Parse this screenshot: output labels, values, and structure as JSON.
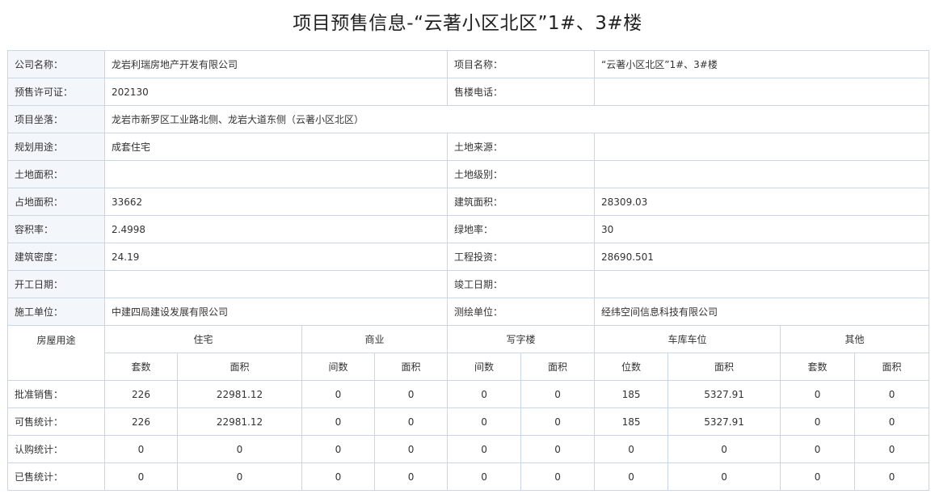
{
  "title": "项目预售信息-“云著小区北区”1#、3#楼",
  "info": {
    "company_label": "公司名称：",
    "company": "龙岩利瑞房地产开发有限公司",
    "project_label": "项目名称：",
    "project": "“云著小区北区”1#、3#楼",
    "permit_label": "预售许可证：",
    "permit": "202130",
    "phone_label": "售楼电话：",
    "phone": "",
    "location_label": "项目坐落：",
    "location": "龙岩市新罗区工业路北侧、龙岩大道东侧（云著小区北区）",
    "use_label": "规划用途：",
    "use": "成套住宅",
    "land_source_label": "土地来源：",
    "land_source": "",
    "land_area_label": "土地面积：",
    "land_area": "",
    "land_grade_label": "土地级别：",
    "land_grade": "",
    "site_area_label": "占地面积：",
    "site_area": "33662",
    "floor_area_label": "建筑面积：",
    "floor_area": "28309.03",
    "far_label": "容积率：",
    "far": "2.4998",
    "green_label": "绿地率：",
    "green": "30",
    "density_label": "建筑密度：",
    "density": "24.19",
    "investment_label": "工程投资：",
    "investment": "28690.501",
    "start_label": "开工日期：",
    "start": "",
    "finish_label": "竣工日期：",
    "finish": "",
    "builder_label": "施工单位：",
    "builder": "中建四局建设发展有限公司",
    "surveyor_label": "测绘单位：",
    "surveyor": "经纬空间信息科技有限公司"
  },
  "stats": {
    "corner": "房屋用途",
    "groups": [
      "住宅",
      "商业",
      "写字楼",
      "车库车位",
      "其他"
    ],
    "subs": [
      "套数",
      "面积",
      "间数",
      "面积",
      "间数",
      "面积",
      "位数",
      "面积",
      "套数",
      "面积"
    ],
    "rows": [
      {
        "label": "批准销售：",
        "values": [
          "226",
          "22981.12",
          "0",
          "0",
          "0",
          "0",
          "185",
          "5327.91",
          "0",
          "0"
        ]
      },
      {
        "label": "可售统计：",
        "values": [
          "226",
          "22981.12",
          "0",
          "0",
          "0",
          "0",
          "185",
          "5327.91",
          "0",
          "0"
        ]
      },
      {
        "label": "认购统计：",
        "values": [
          "0",
          "0",
          "0",
          "0",
          "0",
          "0",
          "0",
          "0",
          "0",
          "0"
        ]
      },
      {
        "label": "已售统计：",
        "values": [
          "0",
          "0",
          "0",
          "0",
          "0",
          "0",
          "0",
          "0",
          "0",
          "0"
        ]
      }
    ]
  }
}
